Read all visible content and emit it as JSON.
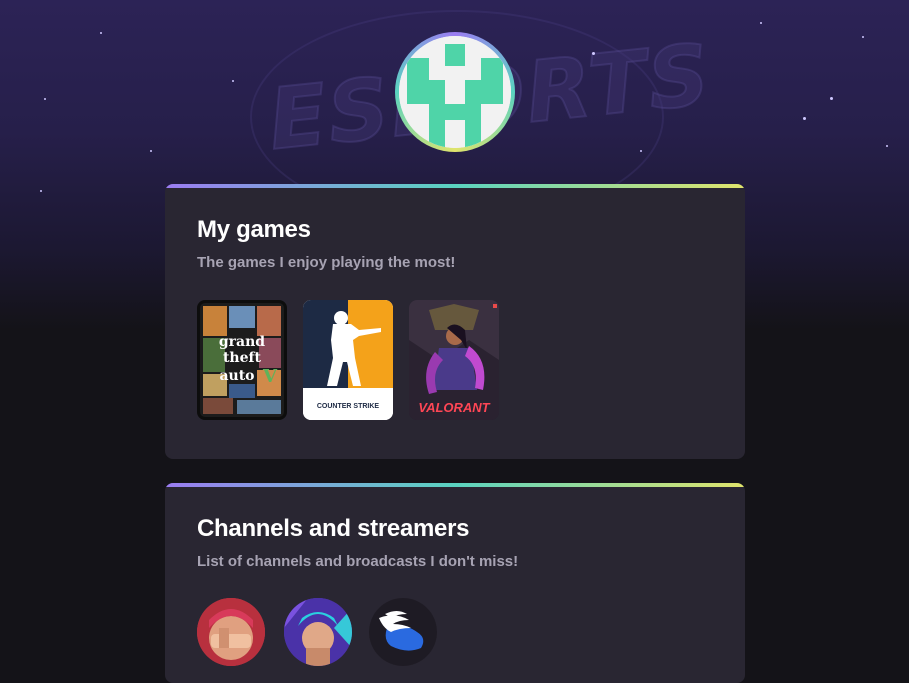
{
  "profile": {
    "avatar_icon": "pixel-person-icon",
    "avatar_color": "#4fd4a8",
    "background_word": "ESPORTS"
  },
  "games_card": {
    "title": "My games",
    "subtitle": "The games I enjoy playing the most!",
    "games": [
      {
        "name": "grand theft auto V",
        "label": "Grand Theft Auto V"
      },
      {
        "name": "counter-strike",
        "label": "COUNTER STRIKE"
      },
      {
        "name": "valorant",
        "label": "VALORANT"
      }
    ]
  },
  "channels_card": {
    "title": "Channels and streamers",
    "subtitle": "List of channels and broadcasts I don't miss!",
    "channels": [
      {
        "name": "streamer-1"
      },
      {
        "name": "streamer-2"
      },
      {
        "name": "winged-logo-channel"
      }
    ]
  },
  "colors": {
    "gradient_start": "#9b7cf2",
    "gradient_mid": "#5ad3c0",
    "gradient_end": "#e0e46c",
    "card_bg": "#292632",
    "page_bg": "#141318"
  }
}
